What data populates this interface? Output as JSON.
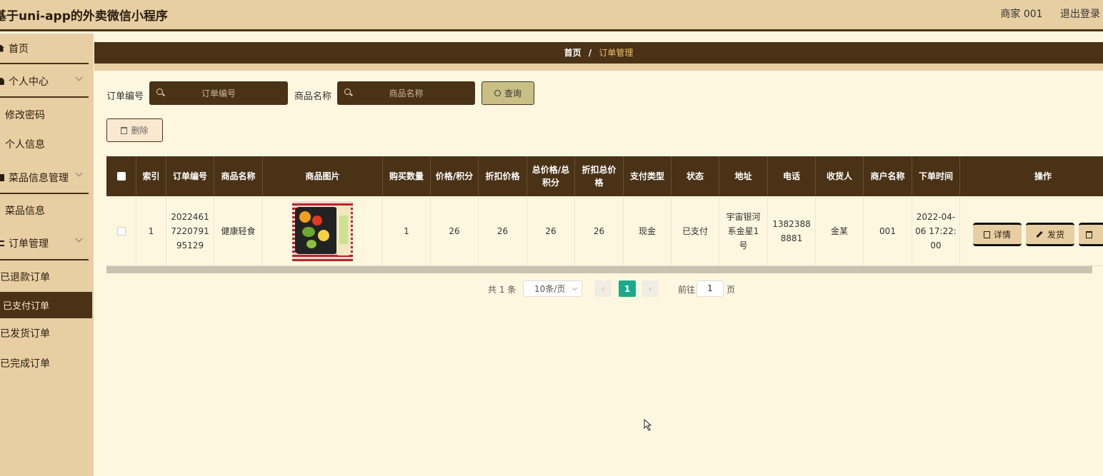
{
  "header": {
    "title": "基于uni-app的外卖微信小程序",
    "user": "商家 001",
    "logout": "退出登录"
  },
  "sidebar": {
    "home": "首页",
    "personal_center": "个人中心",
    "change_password": "修改密码",
    "personal_info": "个人信息",
    "dish_mgmt": "菜品信息管理",
    "dish_info": "菜品信息",
    "order_mgmt": "订单管理",
    "refunded_orders": "已退款订单",
    "paid_orders": "已支付订单",
    "shipped_orders": "已发货订单",
    "completed_orders": "已完成订单"
  },
  "breadcrumb": {
    "home": "首页",
    "sep": "/",
    "current": "订单管理"
  },
  "search": {
    "order_no_label": "订单编号",
    "order_no_placeholder": "订单编号",
    "product_label": "商品名称",
    "product_placeholder": "商品名称",
    "query_button": "查询",
    "delete_button": "删除"
  },
  "table": {
    "headers": {
      "index": "索引",
      "order_no": "订单编号",
      "product_name": "商品名称",
      "product_image": "商品图片",
      "quantity": "购买数量",
      "price_points": "价格/积分",
      "discount_price": "折扣价格",
      "total_price_points": "总价格/总积分",
      "discount_total": "折扣总价格",
      "pay_type": "支付类型",
      "status": "状态",
      "address": "地址",
      "phone": "电话",
      "receiver": "收货人",
      "merchant": "商户名称",
      "order_time": "下单时间",
      "actions": "操作"
    },
    "rows": [
      {
        "index": "1",
        "order_no": "2022461722079195129",
        "product_name": "健康轻食",
        "quantity": "1",
        "price_points": "26",
        "discount_price": "26",
        "total_price_points": "26",
        "discount_total": "26",
        "pay_type": "现金",
        "status": "已支付",
        "address": "宇宙银河系金星1号",
        "phone": "13823888881",
        "receiver": "金某",
        "merchant": "001",
        "order_time": "2022-04-06 17:22:00",
        "detail_button": "详情",
        "ship_button": "发货"
      }
    ]
  },
  "pagination": {
    "total": "共 1 条",
    "page_size": "10条/页",
    "prev": "‹",
    "current_page": "1",
    "next": "›",
    "goto": "前往",
    "goto_value": "1",
    "page_unit": "页"
  }
}
